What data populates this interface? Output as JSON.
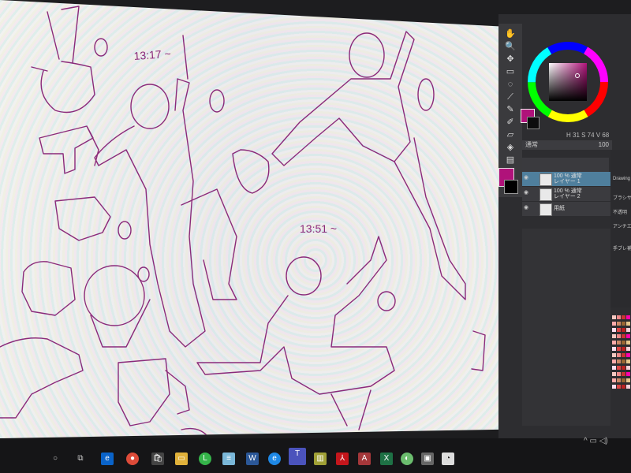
{
  "sketch": {
    "time_note_1": "13:17 ~",
    "time_note_2": "13:51 ~"
  },
  "colors": {
    "sketch_line": "#8a2a7a",
    "main_color": "#b0127a",
    "sub_color": "#0d0d0d",
    "selected_layer": "#4f7f9d",
    "panel_bg": "#2d2d30"
  },
  "color_panel": {
    "values": "H 31 S 74 V 68"
  },
  "layer_panel": {
    "blend_mode": "通常",
    "opacity": "100",
    "layers": [
      {
        "line1": "100 % 通常",
        "line2": "レイヤー 1",
        "selected": true
      },
      {
        "line1": "100 % 通常",
        "line2": "レイヤー 2",
        "selected": false
      },
      {
        "line1": "",
        "line2": "用紙",
        "selected": false
      }
    ]
  },
  "right_column_labels": [
    "Drawing",
    "ブラシサ",
    "不透明",
    "アンチエ",
    "手ブレ補"
  ],
  "tools": [
    "hand-icon",
    "zoom-icon",
    "move-icon",
    "select-icon",
    "lasso-icon",
    "eyedropper-icon",
    "pen-icon",
    "brush-icon",
    "eraser-icon",
    "fill-icon",
    "gradient-icon",
    "text-icon"
  ],
  "taskbar": {
    "apps": [
      "search-icon",
      "task-view-icon",
      "edge-icon",
      "chrome-icon",
      "store-icon",
      "file-explorer-icon",
      "line-icon",
      "notepad-icon",
      "word-icon",
      "ie-icon",
      "teams-icon",
      "app-icon",
      "acrobat-icon",
      "access-icon",
      "excel-icon",
      "maps-icon",
      "device-icon",
      "clip-studio-icon"
    ],
    "tray": "^ ▭ ◁)"
  }
}
